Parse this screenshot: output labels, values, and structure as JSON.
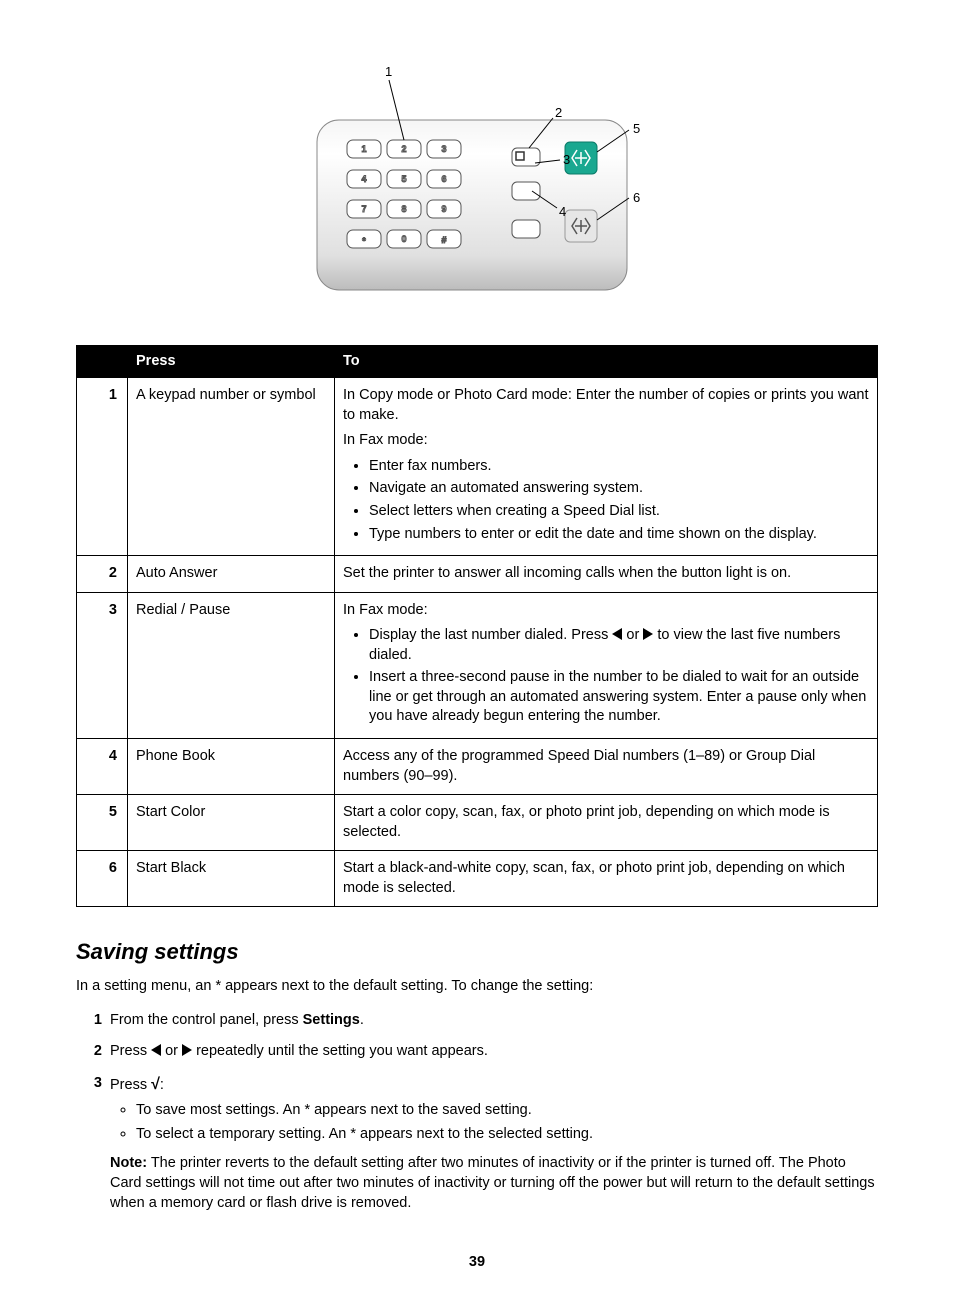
{
  "diagram": {
    "callouts": [
      "1",
      "2",
      "3",
      "4",
      "5",
      "6"
    ],
    "key_labels": [
      "1",
      "2",
      "3",
      "4",
      "5",
      "6",
      "7",
      "8",
      "9",
      "*",
      "0",
      "#"
    ]
  },
  "table": {
    "headers": {
      "num": "",
      "press": "Press",
      "to": "To"
    },
    "rows": [
      {
        "num": "1",
        "press": "A keypad number or symbol",
        "to_intro": "In Copy mode or Photo Card mode: Enter the number of copies or prints you want to make.",
        "to_mode": "In Fax mode:",
        "to_bullets": [
          "Enter fax numbers.",
          "Navigate an automated answering system.",
          "Select letters when creating a Speed Dial list.",
          "Type numbers to enter or edit the date and time shown on the display."
        ]
      },
      {
        "num": "2",
        "press": "Auto Answer",
        "to_text": "Set the printer to answer all incoming calls when the button light is on."
      },
      {
        "num": "3",
        "press": "Redial / Pause",
        "to_mode": "In Fax mode:",
        "to_bullets_rich": [
          {
            "pre": "Display the last number dialed. Press ",
            "arrows": true,
            "post": " to view the last five numbers dialed."
          },
          {
            "text": "Insert a three-second pause in the number to be dialed to wait for an outside line or get through an automated answering system. Enter a pause only when you have already begun entering the number."
          }
        ]
      },
      {
        "num": "4",
        "press": "Phone Book",
        "to_text": "Access any of the programmed Speed Dial numbers (1–89) or Group Dial numbers (90–99)."
      },
      {
        "num": "5",
        "press": "Start Color",
        "to_text": "Start a color copy, scan, fax, or photo print job, depending on which mode is selected."
      },
      {
        "num": "6",
        "press": "Start Black",
        "to_text": "Start a black-and-white copy, scan, fax, or photo print job, depending on which mode is selected."
      }
    ]
  },
  "saving": {
    "heading": "Saving settings",
    "intro": "In a setting menu, an * appears next to the default setting. To change the setting:",
    "steps": [
      {
        "num": "1",
        "text_pre": "From the control panel, press ",
        "bold": "Settings",
        "text_post": "."
      },
      {
        "num": "2",
        "text_pre": "Press ",
        "arrows": true,
        "text_post": " repeatedly until the setting you want appears."
      },
      {
        "num": "3",
        "text_pre": "Press ",
        "check": true,
        "text_post": ":",
        "bullets": [
          "To save most settings. An * appears next to the saved setting.",
          "To select a temporary setting. An * appears next to the selected setting."
        ],
        "note_label": "Note:",
        "note_text": " The printer reverts to the default setting after two minutes of inactivity or if the printer is turned off. The Photo Card settings will not time out after two minutes of inactivity or turning off the power but will return to the default settings when a memory card or flash drive is removed."
      }
    ]
  },
  "page_number": "39"
}
